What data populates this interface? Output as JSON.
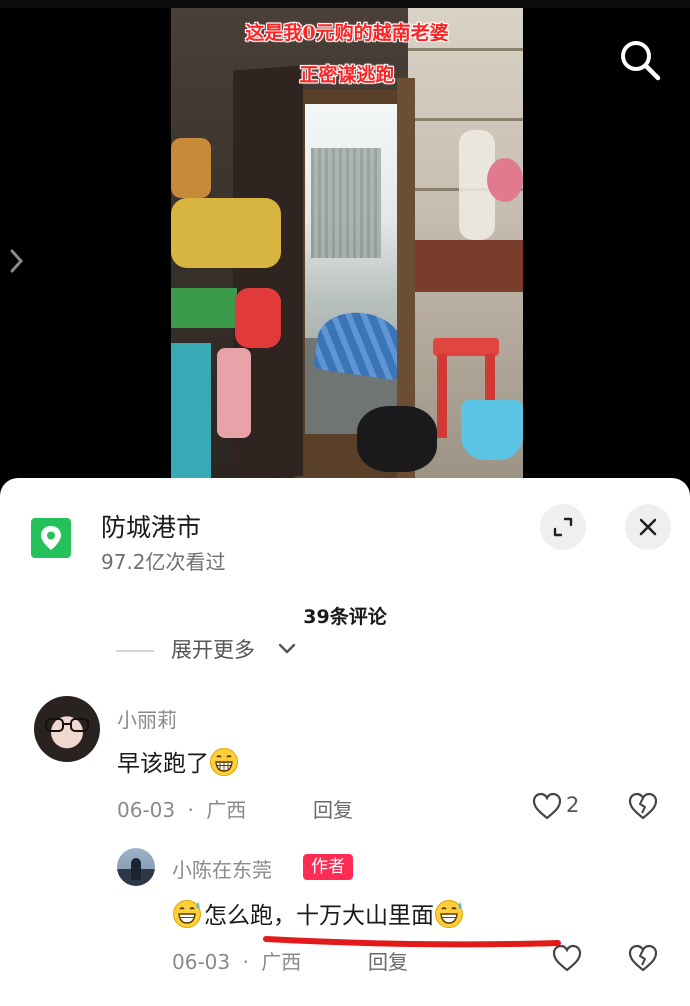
{
  "video": {
    "caption_line1": "这是我0元购的越南老婆",
    "caption_line2": "正密谋逃跑",
    "search_icon": "search-icon",
    "side_icon": "chevron-right-icon"
  },
  "location": {
    "icon": "location-pin-icon",
    "title": "防城港市",
    "views": "97.2亿次看过",
    "accent": "#25c15a"
  },
  "header_buttons": {
    "expand_icon": "expand-icon",
    "close_icon": "close-icon"
  },
  "comments_count": "39条评论",
  "expand_more": "展开更多",
  "comments": [
    {
      "user": "小丽莉",
      "text": "早该跑了",
      "emoji": "grinning-face",
      "date": "06-03",
      "region": "广西",
      "separator": "·",
      "reply_label": "回复",
      "likes": "2"
    }
  ],
  "reply": {
    "user": "小陈在东莞",
    "badge": "作者",
    "badge_color": "#fe2c55",
    "text": "怎么跑，十万大山里面",
    "emoji": "grinning-face-with-sweat",
    "date": "06-03",
    "region": "广西",
    "separator": "·",
    "reply_label": "回复"
  }
}
